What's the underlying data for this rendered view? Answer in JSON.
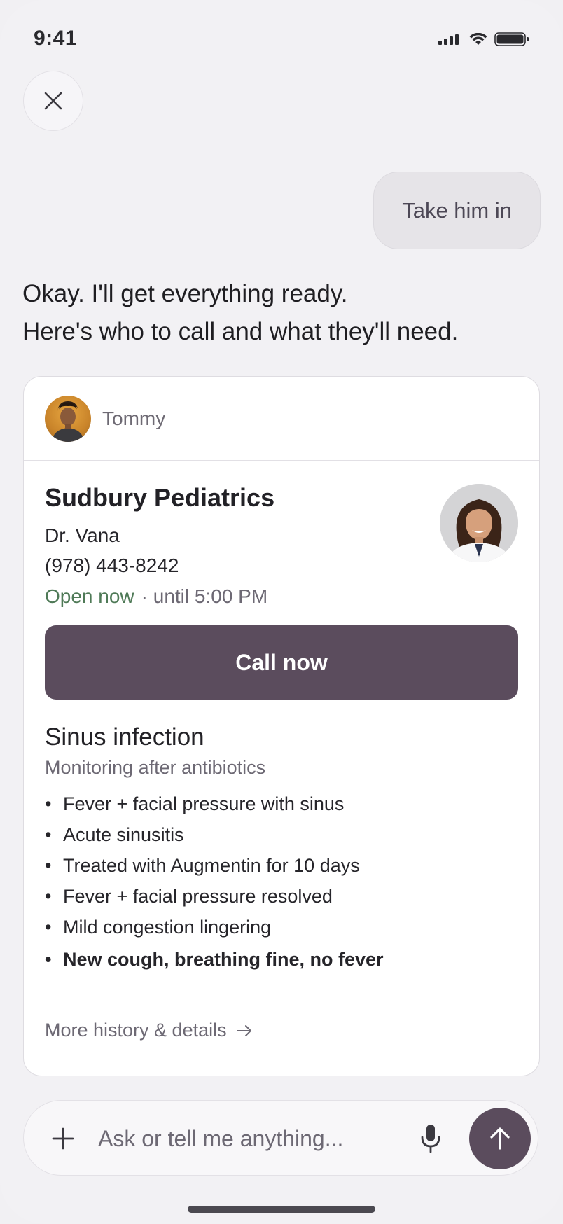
{
  "status_bar": {
    "time": "9:41"
  },
  "icons": {
    "close": "close-icon",
    "patient": "avatar",
    "plus": "plus-icon",
    "mic": "microphone-icon",
    "send": "arrow-up-icon",
    "more_arrow": "arrow-right-icon"
  },
  "conversation": {
    "user_message": "Take him in",
    "assistant_lines": [
      "Okay. I'll get everything ready.",
      "Here's who to call and what they'll need."
    ]
  },
  "card": {
    "patient_name": "Tommy",
    "clinic_name": "Sudbury Pediatrics",
    "doctor": "Dr. Vana",
    "phone": "(978) 443-8242",
    "open_status": "Open now",
    "hours": "· until 5:00 PM",
    "call_button": "Call now",
    "condition_title": "Sinus infection",
    "condition_subtitle": "Monitoring after antibiotics",
    "bullets": [
      "Fever + facial pressure with sinus",
      "Acute sinusitis",
      "Treated with Augmentin for 10 days",
      "Fever + facial pressure resolved",
      "Mild congestion lingering",
      "New cough, breathing fine, no fever"
    ],
    "more_link": "More history & details"
  },
  "composer": {
    "placeholder": "Ask or tell me anything..."
  },
  "colors": {
    "accent": "#5b4c5d",
    "open_green": "#4f7a57",
    "background": "#f2f1f4"
  }
}
